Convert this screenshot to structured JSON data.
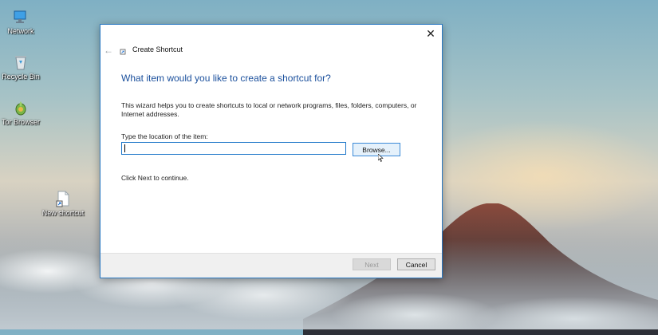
{
  "desktop": {
    "icons": [
      {
        "label": "Network",
        "icon": "network-icon"
      },
      {
        "label": "Recycle Bin",
        "icon": "recycle-bin-icon"
      },
      {
        "label": "Tor Browser",
        "icon": "tor-browser-icon"
      },
      {
        "label": "New shortcut",
        "icon": "shortcut-file-icon"
      }
    ]
  },
  "dialog": {
    "close_glyph": "✕",
    "back_glyph": "←",
    "title": "Create Shortcut",
    "heading": "What item would you like to create a shortcut for?",
    "description": "This wizard helps you to create shortcuts to local or network programs, files, folders, computers, or Internet addresses.",
    "location_label": "Type the location of the item:",
    "location_value": "",
    "browse_label": "Browse...",
    "continue_text": "Click Next to continue.",
    "next_label": "Next",
    "cancel_label": "Cancel",
    "next_enabled": false
  },
  "colors": {
    "accent": "#2b79c2",
    "heading": "#1a4f9c"
  }
}
